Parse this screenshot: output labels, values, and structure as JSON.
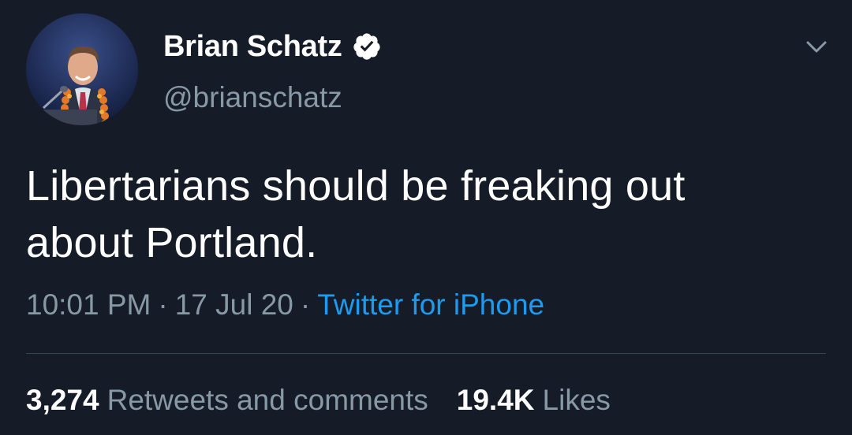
{
  "tweet": {
    "author": {
      "display_name": "Brian Schatz",
      "handle": "@brianschatz",
      "verified": true
    },
    "text_lines": [
      "Libertarians should be freaking out",
      "about Portland."
    ],
    "time": "10:01 PM",
    "separator": "·",
    "date": "17 Jul 20",
    "source": "Twitter for iPhone",
    "stats": {
      "retweets_count": "3,274",
      "retweets_label": "Retweets and comments",
      "likes_count": "19.4K",
      "likes_label": "Likes"
    }
  },
  "colors": {
    "background": "#151c27",
    "text_primary": "#ffffff",
    "text_secondary": "#8899a6",
    "link": "#1d9bf0",
    "divider": "#38444d"
  },
  "icons": {
    "verified": "verified-badge-icon",
    "menu": "chevron-down-icon"
  }
}
